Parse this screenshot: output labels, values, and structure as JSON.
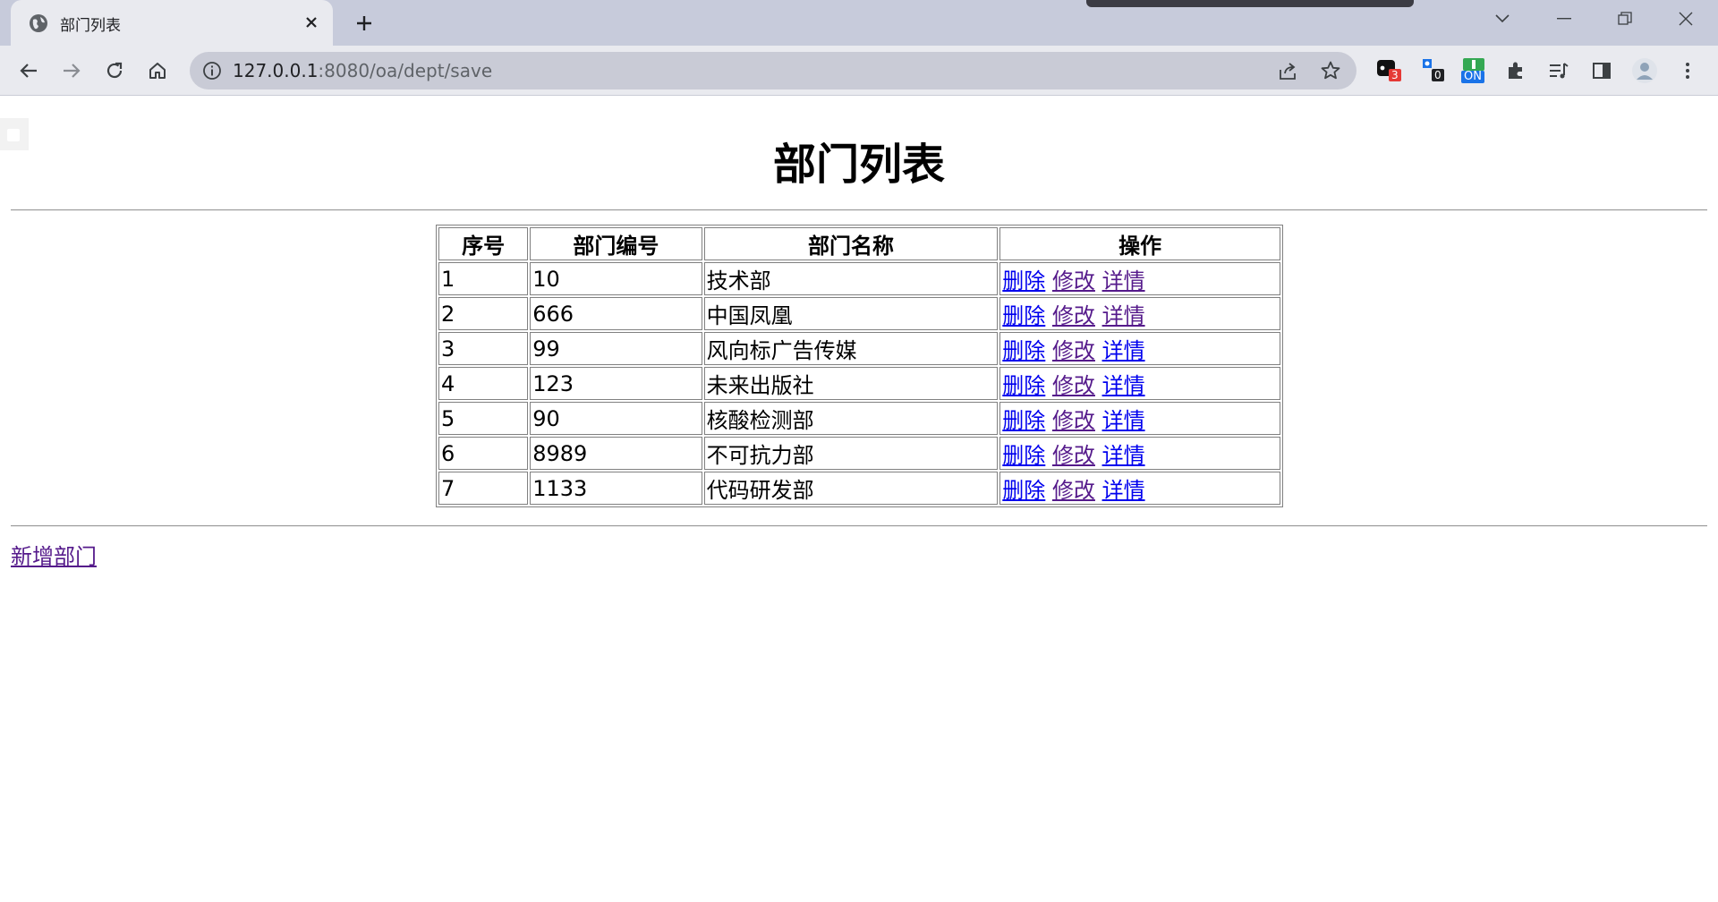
{
  "browser": {
    "tab_title": "部门列表",
    "url_host": "127.0.0.1",
    "url_rest": ":8080/oa/dept/save",
    "extensions": [
      {
        "name": "extension-1",
        "badge": "3",
        "badge_color": "#e53935"
      },
      {
        "name": "extension-2",
        "badge": "0",
        "badge_color": "#202124"
      },
      {
        "name": "extension-3",
        "badge": "ON",
        "badge_color": "#1a73e8"
      }
    ]
  },
  "page": {
    "title": "部门列表",
    "table": {
      "headers": [
        "序号",
        "部门编号",
        "部门名称",
        "操作"
      ],
      "rows": [
        {
          "index": "1",
          "deptno": "10",
          "dname": "技术部"
        },
        {
          "index": "2",
          "deptno": "666",
          "dname": "中国凤凰"
        },
        {
          "index": "3",
          "deptno": "99",
          "dname": "风向标广告传媒"
        },
        {
          "index": "4",
          "deptno": "123",
          "dname": "未来出版社"
        },
        {
          "index": "5",
          "deptno": "90",
          "dname": "核酸检测部"
        },
        {
          "index": "6",
          "deptno": "8989",
          "dname": "不可抗力部"
        },
        {
          "index": "7",
          "deptno": "1133",
          "dname": "代码研发部"
        }
      ],
      "actions": {
        "delete": "删除",
        "edit": "修改",
        "detail": "详情"
      }
    },
    "add_link": "新增部门"
  },
  "colors": {
    "link": "#0000ee",
    "visited_link": "#551a8b",
    "tabbar_bg": "#c7cbdb",
    "toolbar_bg": "#e9eaef"
  }
}
